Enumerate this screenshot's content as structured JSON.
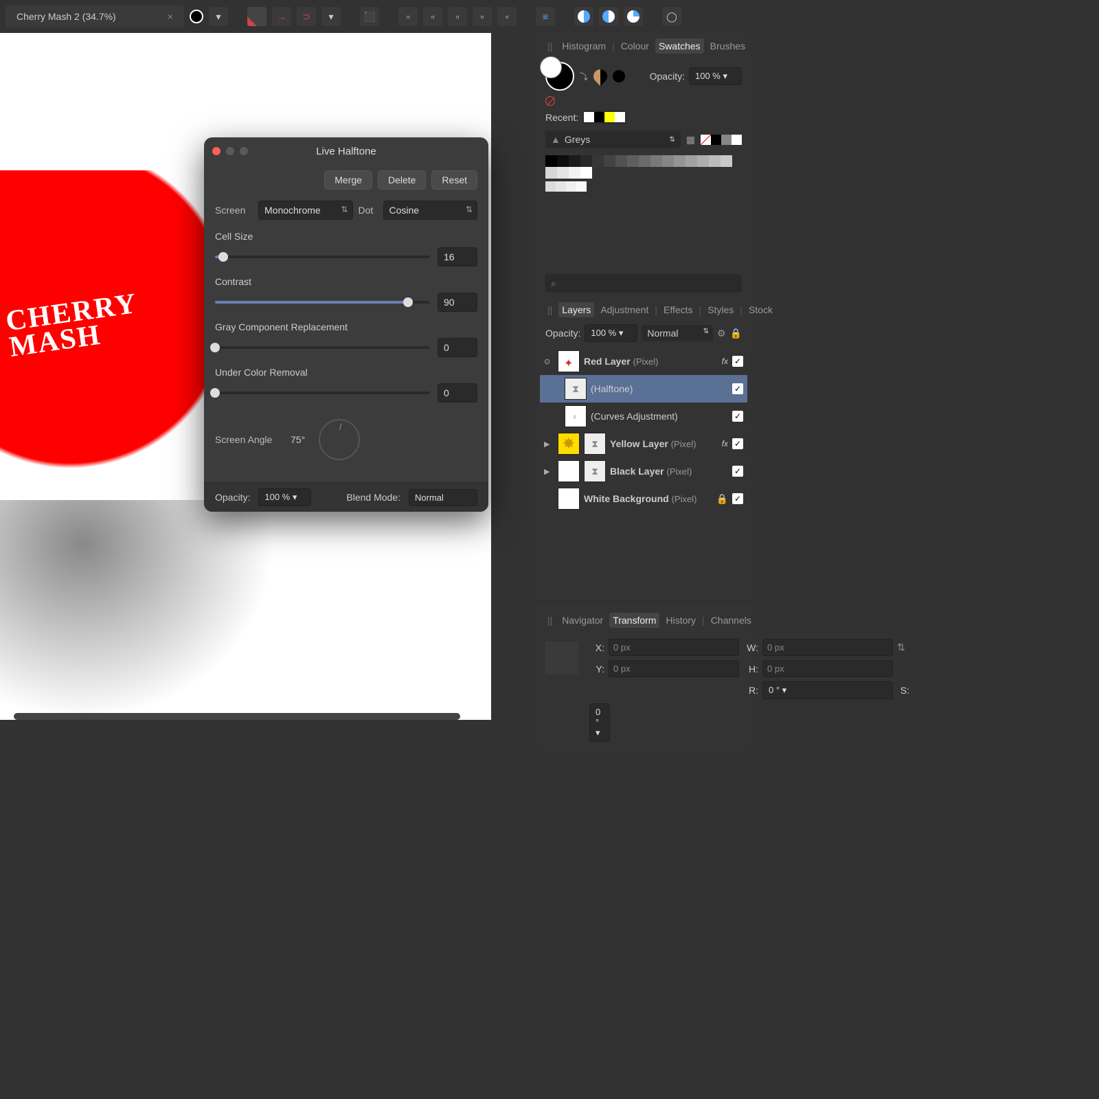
{
  "doc": {
    "title": "Cherry Mash 2 (34.7%)"
  },
  "dialog": {
    "title": "Live Halftone",
    "merge": "Merge",
    "delete": "Delete",
    "reset": "Reset",
    "screen_lbl": "Screen",
    "screen_val": "Monochrome",
    "dot_lbl": "Dot",
    "dot_val": "Cosine",
    "cell_lbl": "Cell Size",
    "cell_val": "16",
    "contrast_lbl": "Contrast",
    "contrast_val": "90",
    "gcr_lbl": "Gray Component Replacement",
    "gcr_val": "0",
    "ucr_lbl": "Under Color Removal",
    "ucr_val": "0",
    "angle_lbl": "Screen Angle",
    "angle_val": "75°",
    "opacity_lbl": "Opacity:",
    "opacity_val": "100 %",
    "blend_lbl": "Blend Mode:",
    "blend_val": "Normal"
  },
  "panels": {
    "tabs1": [
      "Histogram",
      "Colour",
      "Swatches",
      "Brushes"
    ],
    "opacity_lbl": "Opacity:",
    "opacity_val": "100 %",
    "recent_lbl": "Recent:",
    "recent_colors": [
      "#ffffff",
      "#000000",
      "#ffff00",
      "#ffffff"
    ],
    "palette": "Greys",
    "tabs2": [
      "Layers",
      "Adjustment",
      "Effects",
      "Styles",
      "Stock"
    ],
    "layer_opacity_lbl": "Opacity:",
    "layer_opacity_val": "100 %",
    "layer_blend": "Normal",
    "layers": [
      {
        "name": "Red Layer",
        "type": "(Pixel)",
        "fx": true,
        "expanded": true,
        "children": [
          {
            "name": "(Halftone)",
            "selected": true
          },
          {
            "name": "(Curves Adjustment)"
          }
        ]
      },
      {
        "name": "Yellow Layer",
        "type": "(Pixel)",
        "fx": true,
        "thumb": "#ffdd00"
      },
      {
        "name": "Black Layer",
        "type": "(Pixel)"
      },
      {
        "name": "White Background",
        "type": "(Pixel)",
        "locked": true
      }
    ],
    "tabs3": [
      "Navigator",
      "Transform",
      "History",
      "Channels"
    ],
    "transform": {
      "x_lbl": "X:",
      "x_val": "0 px",
      "y_lbl": "Y:",
      "y_val": "0 px",
      "w_lbl": "W:",
      "w_val": "0 px",
      "h_lbl": "H:",
      "h_val": "0 px",
      "r_lbl": "R:",
      "r_val": "0 °",
      "s_lbl": "S:",
      "s_val": "0 °"
    }
  }
}
